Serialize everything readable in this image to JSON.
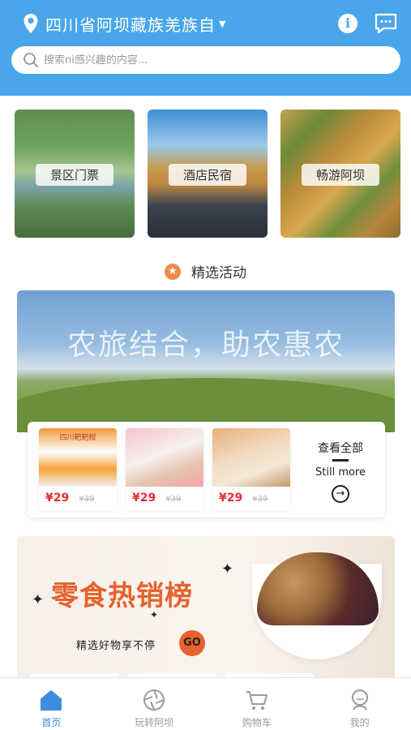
{
  "header": {
    "location": "四川省阿坝藏族羌族自",
    "icons": [
      "location-pin-icon",
      "chevron-down-icon",
      "info-icon",
      "message-icon"
    ]
  },
  "search": {
    "placeholder": "搜索ni感兴趣的内容..."
  },
  "categories": [
    {
      "label": "景区门票"
    },
    {
      "label": "酒店民宿"
    },
    {
      "label": "畅游阿坝"
    }
  ],
  "featured": {
    "title": "精选活动",
    "banner_text": "农旅结合，助农惠农"
  },
  "products": [
    {
      "badge": "四川耙耙柑",
      "price": "¥29",
      "old_price": "¥39"
    },
    {
      "price": "¥29",
      "old_price": "¥39"
    },
    {
      "price": "¥29",
      "old_price": "¥39"
    }
  ],
  "more": {
    "zh": "查看全部",
    "en": "Still more"
  },
  "snack_banner": {
    "title": "零食热销榜",
    "subtitle": "精选好物享不停",
    "go": "GO"
  },
  "tabs": [
    {
      "label": "首页",
      "active": true
    },
    {
      "label": "玩转阿坝",
      "active": false
    },
    {
      "label": "购物车",
      "active": false
    },
    {
      "label": "我的",
      "active": false
    }
  ],
  "colors": {
    "primary": "#4aa6ea",
    "tab_active": "#3e8ddc",
    "price": "#e52f2f",
    "accent": "#e8612c"
  }
}
